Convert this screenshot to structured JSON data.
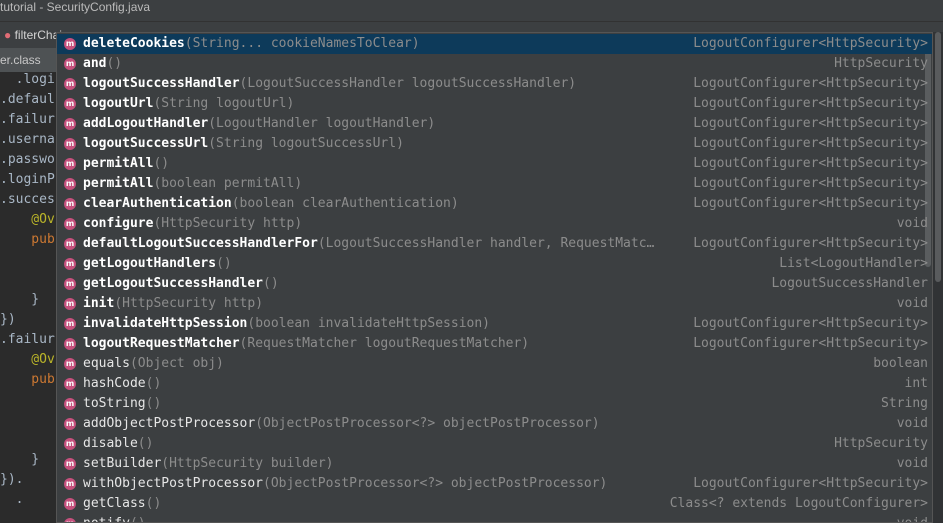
{
  "window": {
    "title": "tutorial - SecurityConfig.java"
  },
  "breadcrumb": {
    "item": "filterChai"
  },
  "editor": {
    "tab_label": "er.class",
    "lines": [
      {
        "text": "  .logi",
        "cls": ""
      },
      {
        "text": ".defaul",
        "cls": ""
      },
      {
        "text": ".failur",
        "cls": ""
      },
      {
        "text": ".userna",
        "cls": ""
      },
      {
        "text": ".passwo",
        "cls": ""
      },
      {
        "text": ".loginP",
        "cls": ""
      },
      {
        "text": ".succes",
        "cls": ""
      },
      {
        "text": "    @Ov",
        "cls": "anno"
      },
      {
        "text": "    pub",
        "cls": "kw"
      },
      {
        "text": "",
        "cls": ""
      },
      {
        "text": "",
        "cls": ""
      },
      {
        "text": "    }",
        "cls": ""
      },
      {
        "text": "})",
        "cls": ""
      },
      {
        "text": ".failur",
        "cls": ""
      },
      {
        "text": "    @Ov",
        "cls": "anno"
      },
      {
        "text": "    pub",
        "cls": "kw"
      },
      {
        "text": "",
        "cls": ""
      },
      {
        "text": "",
        "cls": ""
      },
      {
        "text": "",
        "cls": ""
      },
      {
        "text": "    }",
        "cls": ""
      },
      {
        "text": "}).",
        "cls": ""
      },
      {
        "text": "  .",
        "cls": ""
      }
    ]
  },
  "completion": {
    "items": [
      {
        "name": "deleteCookies",
        "params": "(String... cookieNamesToClear)",
        "type": "LogoutConfigurer<HttpSecurity>",
        "bold": true,
        "selected": true
      },
      {
        "name": "and",
        "params": "()",
        "type": "HttpSecurity",
        "bold": true
      },
      {
        "name": "logoutSuccessHandler",
        "params": "(LogoutSuccessHandler logoutSuccessHandler)",
        "type": "LogoutConfigurer<HttpSecurity>",
        "bold": true
      },
      {
        "name": "logoutUrl",
        "params": "(String logoutUrl)",
        "type": "LogoutConfigurer<HttpSecurity>",
        "bold": true
      },
      {
        "name": "addLogoutHandler",
        "params": "(LogoutHandler logoutHandler)",
        "type": "LogoutConfigurer<HttpSecurity>",
        "bold": true
      },
      {
        "name": "logoutSuccessUrl",
        "params": "(String logoutSuccessUrl)",
        "type": "LogoutConfigurer<HttpSecurity>",
        "bold": true
      },
      {
        "name": "permitAll",
        "params": "()",
        "type": "LogoutConfigurer<HttpSecurity>",
        "bold": true
      },
      {
        "name": "permitAll",
        "params": "(boolean permitAll)",
        "type": "LogoutConfigurer<HttpSecurity>",
        "bold": true
      },
      {
        "name": "clearAuthentication",
        "params": "(boolean clearAuthentication)",
        "type": "LogoutConfigurer<HttpSecurity>",
        "bold": true
      },
      {
        "name": "configure",
        "params": "(HttpSecurity http)",
        "type": "void",
        "bold": true
      },
      {
        "name": "defaultLogoutSuccessHandlerFor",
        "params": "(LogoutSuccessHandler handler, RequestMatc…",
        "type": "LogoutConfigurer<HttpSecurity>",
        "bold": true
      },
      {
        "name": "getLogoutHandlers",
        "params": "()",
        "type": "List<LogoutHandler>",
        "bold": true
      },
      {
        "name": "getLogoutSuccessHandler",
        "params": "()",
        "type": "LogoutSuccessHandler",
        "bold": true
      },
      {
        "name": "init",
        "params": "(HttpSecurity http)",
        "type": "void",
        "bold": true
      },
      {
        "name": "invalidateHttpSession",
        "params": "(boolean invalidateHttpSession)",
        "type": "LogoutConfigurer<HttpSecurity>",
        "bold": true
      },
      {
        "name": "logoutRequestMatcher",
        "params": "(RequestMatcher logoutRequestMatcher)",
        "type": "LogoutConfigurer<HttpSecurity>",
        "bold": true
      },
      {
        "name": "equals",
        "params": "(Object obj)",
        "type": "boolean",
        "bold": false
      },
      {
        "name": "hashCode",
        "params": "()",
        "type": "int",
        "bold": false
      },
      {
        "name": "toString",
        "params": "()",
        "type": "String",
        "bold": false
      },
      {
        "name": "addObjectPostProcessor",
        "params": "(ObjectPostProcessor<?> objectPostProcessor)",
        "type": "void",
        "bold": false
      },
      {
        "name": "disable",
        "params": "()",
        "type": "HttpSecurity",
        "bold": false
      },
      {
        "name": "setBuilder",
        "params": "(HttpSecurity builder)",
        "type": "void",
        "bold": false
      },
      {
        "name": "withObjectPostProcessor",
        "params": "(ObjectPostProcessor<?> objectPostProcessor)",
        "type": "LogoutConfigurer<HttpSecurity>",
        "bold": false
      },
      {
        "name": "getClass",
        "params": "()",
        "type": "Class<? extends LogoutConfigurer>",
        "bold": false
      },
      {
        "name": "notify",
        "params": "()",
        "type": "void",
        "bold": false
      }
    ],
    "icon_letter": "m"
  },
  "colors": {
    "method_icon": "#c5507d",
    "popup_bg": "#3c3f41",
    "selected_row": "#0d3a5a"
  }
}
